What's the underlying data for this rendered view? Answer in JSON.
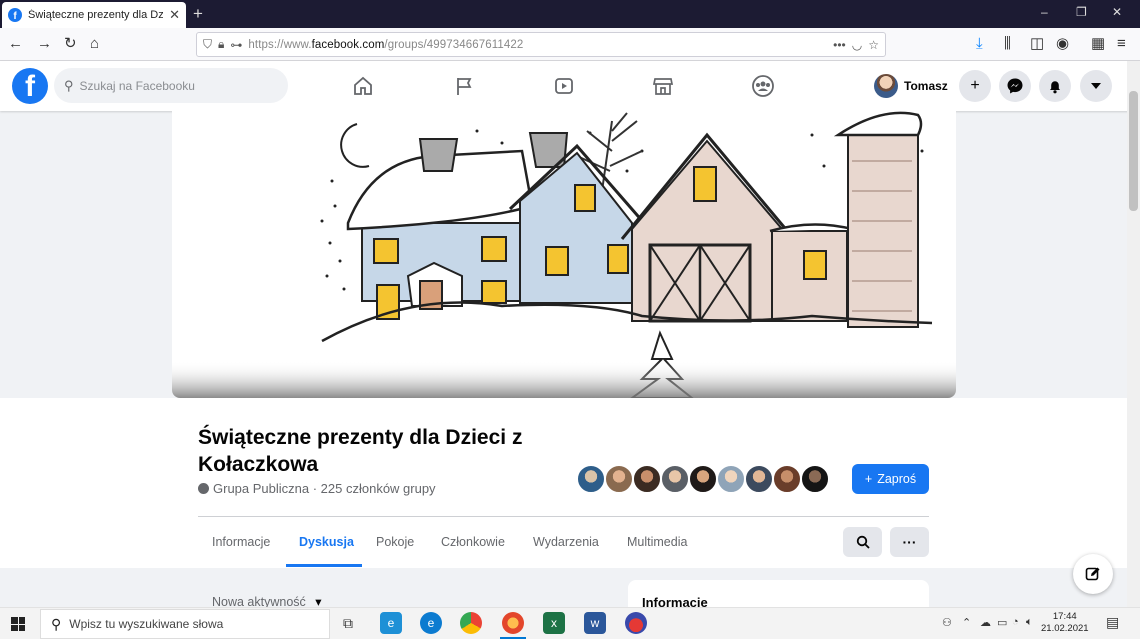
{
  "browser": {
    "tab_title": "Świąteczne prezenty dla Dzieci z",
    "tab_favicon": "f",
    "url_prefix": "https://www.",
    "url_domain": "facebook.com",
    "url_path": "/groups/499734667611422",
    "url_more": "•••",
    "win_minimize": "–",
    "win_maximize": "❐",
    "win_close": "✕",
    "new_tab": "+"
  },
  "facebook": {
    "logo": "f",
    "search_placeholder": "Szukaj na Facebooku",
    "profile_name": "Tomasz",
    "nav_icons": [
      "home-icon",
      "pages-flag-icon",
      "watch-video-icon",
      "marketplace-icon",
      "groups-icon"
    ],
    "accent_color": "#1877f2"
  },
  "group": {
    "title": "Świąteczne prezenty dla Dzieci z Kołaczkowa",
    "meta": "Grupa Publiczna · 225 członków grupy",
    "invite_label": "Zaproś",
    "invite_plus": "+",
    "tabs": [
      "Informacje",
      "Dyskusja",
      "Pokoje",
      "Członkowie",
      "Wydarzenia",
      "Multimedia"
    ],
    "active_tab": "Dyskusja",
    "more_label": "···",
    "member_count_avatars": 9
  },
  "feed": {
    "sort_label": "Nowa aktywność",
    "sort_caret": "▾",
    "info_title": "Informacje"
  },
  "taskbar": {
    "search_placeholder": "Wpisz tu wyszukiwane słowa",
    "time": "17:44",
    "date": "21.02.2021"
  }
}
